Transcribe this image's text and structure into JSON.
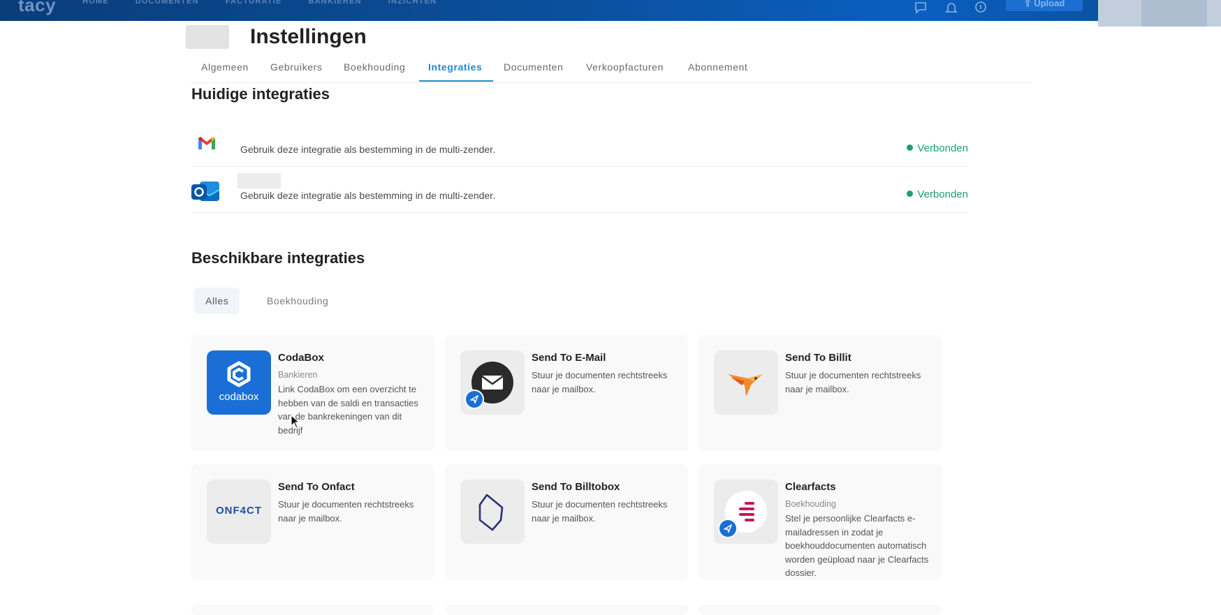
{
  "topbar": {
    "logo": "tacy",
    "nav": [
      "HOME",
      "DOCUMENTEN",
      "FACTURATIE",
      "BANKIEREN",
      "INZICHTEN"
    ],
    "icons": [
      "chat-icon",
      "bell-icon",
      "info-icon"
    ],
    "upload_label": "Upload"
  },
  "page": {
    "title": "Instellingen"
  },
  "tabs": [
    {
      "label": "Algemeen"
    },
    {
      "label": "Gebruikers"
    },
    {
      "label": "Boekhouding"
    },
    {
      "label": "Integraties",
      "active": true
    },
    {
      "label": "Documenten"
    },
    {
      "label": "Verkoopfacturen"
    },
    {
      "label": "Abonnement"
    }
  ],
  "current": {
    "title": "Huidige integraties",
    "items": [
      {
        "icon": "gmail-icon",
        "description": "Gebruik deze integratie als bestemming in de multi-zender.",
        "status": "Verbonden"
      },
      {
        "icon": "outlook-icon",
        "description": "Gebruik deze integratie als bestemming in de multi-zender.",
        "status": "Verbonden"
      }
    ]
  },
  "available": {
    "title": "Beschikbare integraties",
    "filters": [
      {
        "label": "Alles",
        "active": true
      },
      {
        "label": "Boekhouding"
      }
    ],
    "cards": [
      {
        "title": "CodaBox",
        "category": "Bankieren",
        "description": "Link CodaBox om een overzicht te hebben van de saldi en transacties van de bankrekeningen van dit bedrijf",
        "icon": "codabox-logo",
        "icon_text": "codabox"
      },
      {
        "title": "Send To E-Mail",
        "category": "",
        "description": "Stuur je documenten rechtstreeks naar je mailbox.",
        "icon": "email-icon"
      },
      {
        "title": "Send To Billit",
        "category": "",
        "description": "Stuur je documenten rechtstreeks naar je mailbox.",
        "icon": "billit-bird-icon"
      },
      {
        "title": "Send To Onfact",
        "category": "",
        "description": "Stuur je documenten rechtstreeks naar je mailbox.",
        "icon": "onfact-logo",
        "icon_text": "ONF4CT"
      },
      {
        "title": "Send To Billtobox",
        "category": "",
        "description": "Stuur je documenten rechtstreeks naar je mailbox.",
        "icon": "billtobox-icon"
      },
      {
        "title": "Clearfacts",
        "category": "Boekhouding",
        "description": "Stel je persoonlijke Clearfacts e-mailadressen in zodat je boekhouddocumenten automatisch worden geüpload naar je Clearfacts dossier.",
        "icon": "clearfacts-icon"
      }
    ]
  },
  "colors": {
    "accent": "#1d8bd1",
    "connected": "#1d9e77",
    "topbar": "#0b4f9c",
    "codabox": "#1a6fd6"
  }
}
